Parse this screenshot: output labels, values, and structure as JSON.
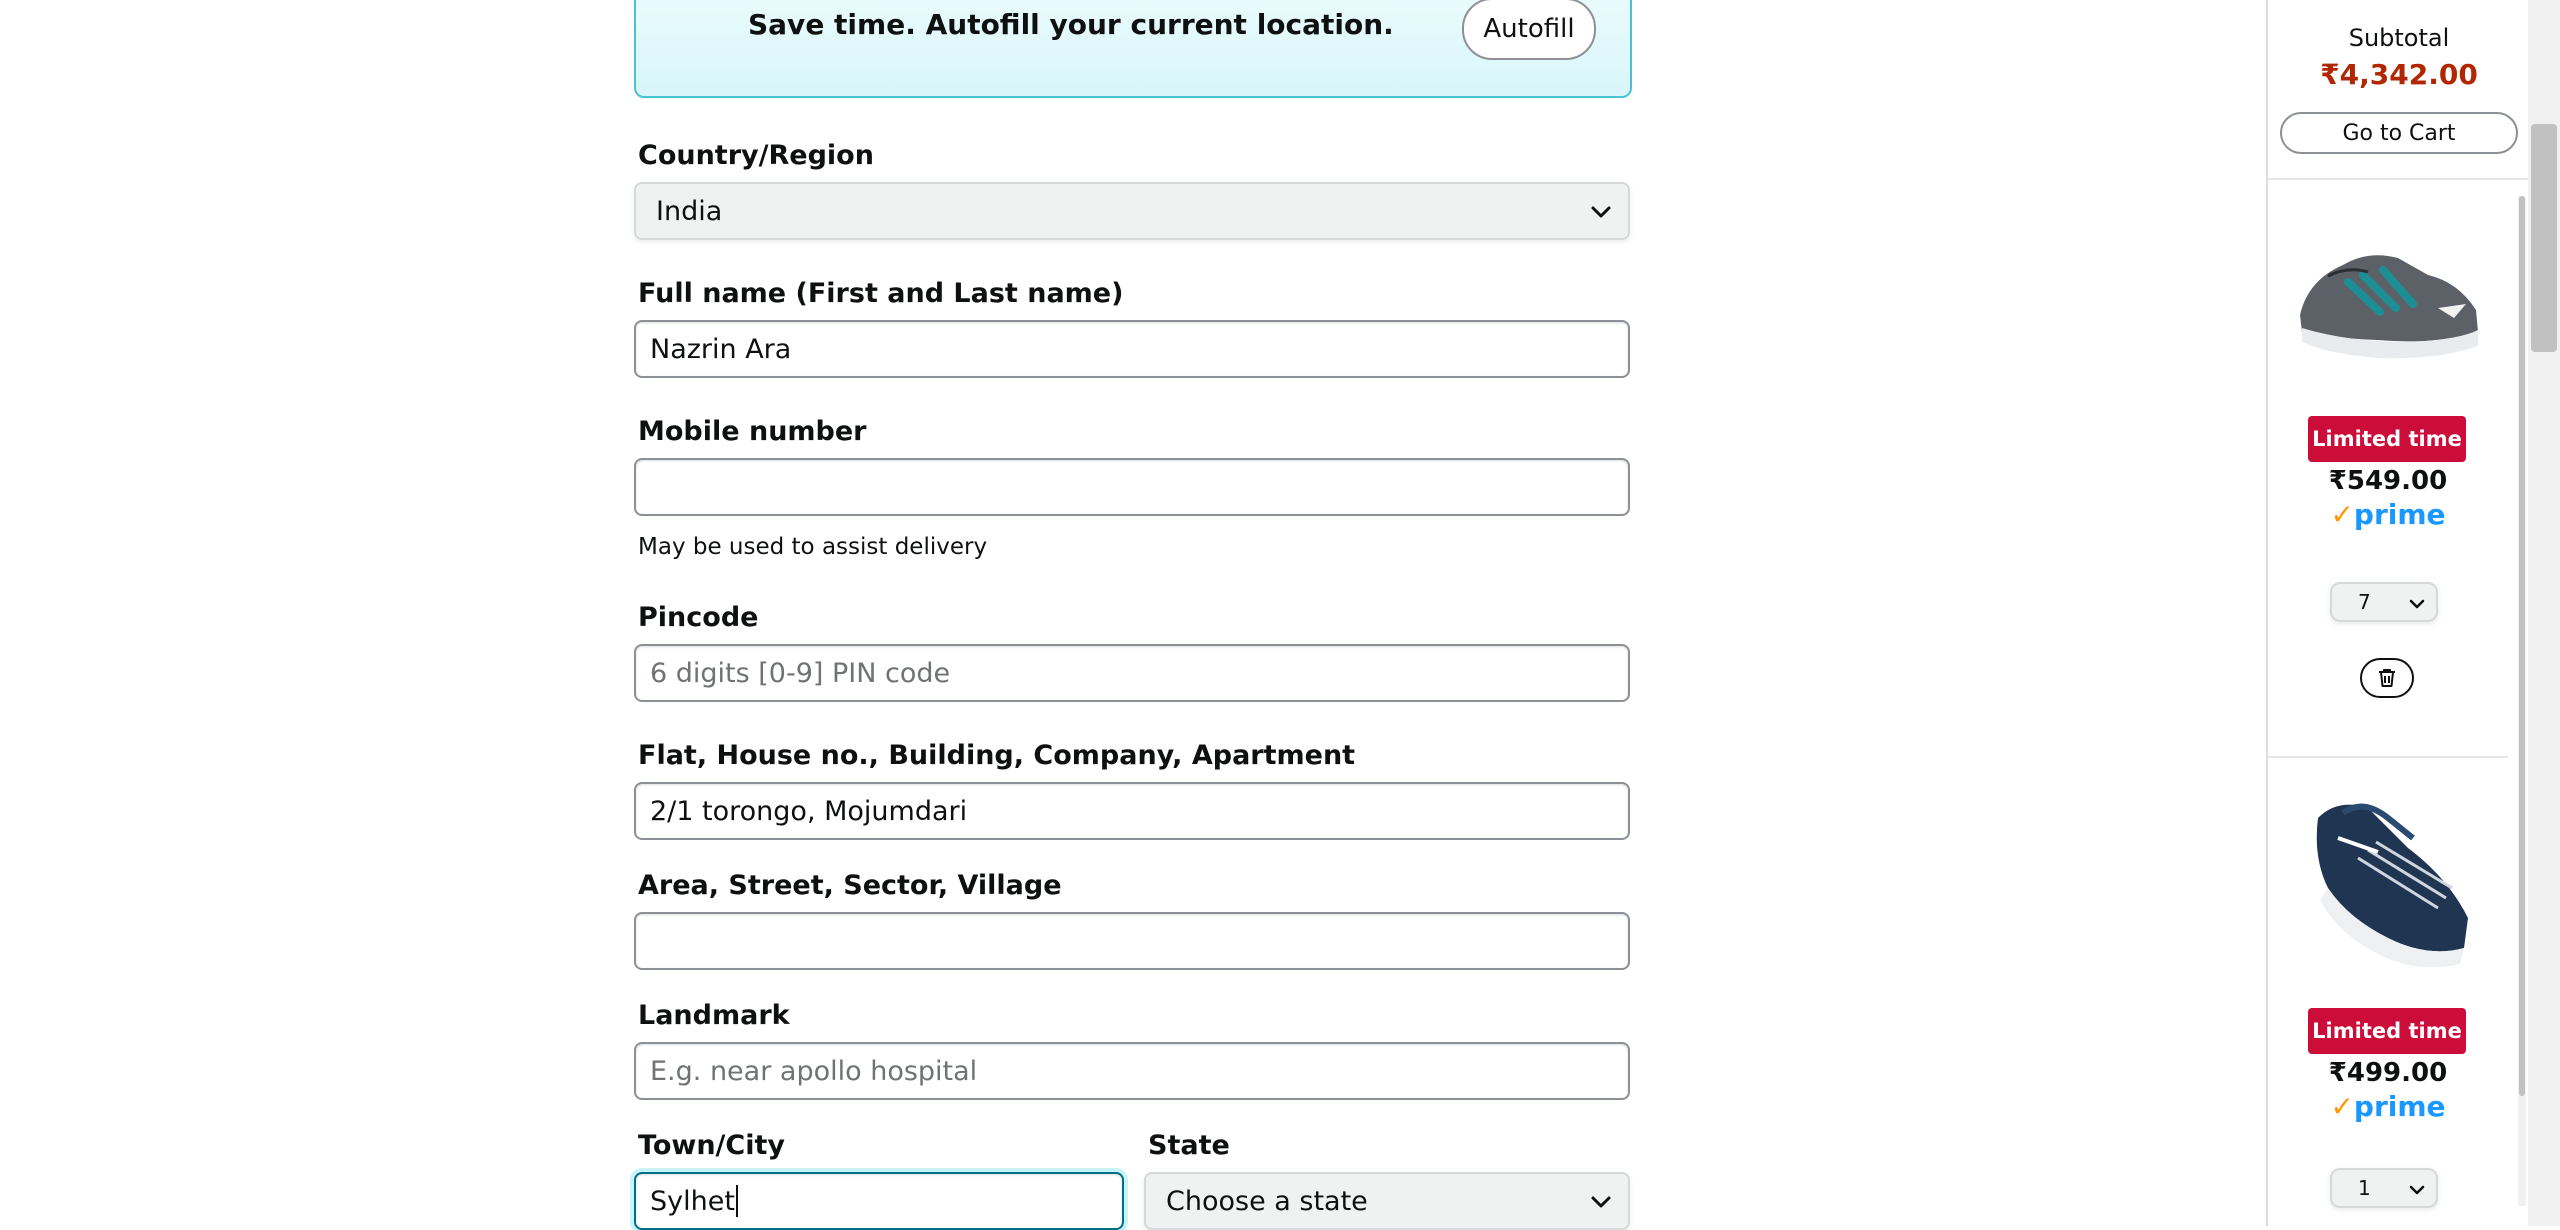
{
  "autofill": {
    "text": "Save time. Autofill your current location.",
    "button_label": "Autofill"
  },
  "form": {
    "country": {
      "label": "Country/Region",
      "value": "India"
    },
    "full_name": {
      "label": "Full name (First and Last name)",
      "value": "Nazrin Ara"
    },
    "mobile": {
      "label": "Mobile number",
      "value": "",
      "hint": "May be used to assist delivery"
    },
    "pincode": {
      "label": "Pincode",
      "value": "",
      "placeholder": "6 digits [0-9] PIN code"
    },
    "flat": {
      "label": "Flat, House no., Building, Company, Apartment",
      "value": "2/1 torongo, Mojumdari"
    },
    "area": {
      "label": "Area, Street, Sector, Village",
      "value": ""
    },
    "landmark": {
      "label": "Landmark",
      "value": "",
      "placeholder": "E.g. near apollo hospital"
    },
    "city": {
      "label": "Town/City",
      "value": "Sylhet"
    },
    "state": {
      "label": "State",
      "value": "Choose a state"
    }
  },
  "cart": {
    "subtotal_label": "Subtotal",
    "subtotal_value": "₹4,342.00",
    "go_to_cart_label": "Go to Cart",
    "items": [
      {
        "badge": "Limited time",
        "price": "₹549.00",
        "prime": "prime",
        "qty": "7",
        "image": "grey-teal-running-shoe"
      },
      {
        "badge": "Limited time",
        "price": "₹499.00",
        "prime": "prime",
        "qty": "1",
        "image": "navy-sports-shoe"
      }
    ]
  },
  "colors": {
    "accent_focus": "#007185",
    "price_red": "#b12704",
    "badge_red": "#cc0c39",
    "prime_blue": "#1a98ff",
    "prime_tick": "#ff9900",
    "autofill_border": "#49c3d3"
  }
}
